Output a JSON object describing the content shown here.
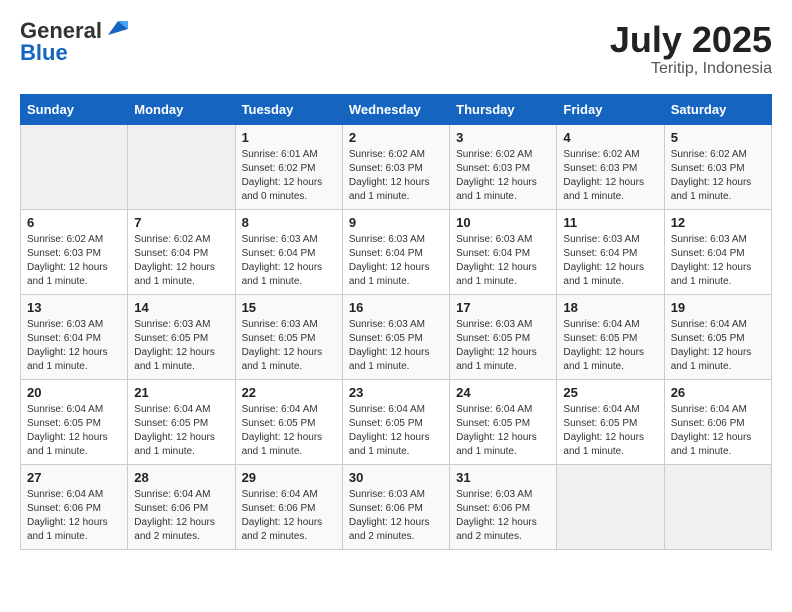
{
  "header": {
    "logo_general": "General",
    "logo_blue": "Blue",
    "month_year": "July 2025",
    "location": "Teritip, Indonesia"
  },
  "days_of_week": [
    "Sunday",
    "Monday",
    "Tuesday",
    "Wednesday",
    "Thursday",
    "Friday",
    "Saturday"
  ],
  "weeks": [
    [
      {
        "day": "",
        "empty": true
      },
      {
        "day": "",
        "empty": true
      },
      {
        "day": "1",
        "sunrise": "Sunrise: 6:01 AM",
        "sunset": "Sunset: 6:02 PM",
        "daylight": "Daylight: 12 hours and 0 minutes."
      },
      {
        "day": "2",
        "sunrise": "Sunrise: 6:02 AM",
        "sunset": "Sunset: 6:03 PM",
        "daylight": "Daylight: 12 hours and 1 minute."
      },
      {
        "day": "3",
        "sunrise": "Sunrise: 6:02 AM",
        "sunset": "Sunset: 6:03 PM",
        "daylight": "Daylight: 12 hours and 1 minute."
      },
      {
        "day": "4",
        "sunrise": "Sunrise: 6:02 AM",
        "sunset": "Sunset: 6:03 PM",
        "daylight": "Daylight: 12 hours and 1 minute."
      },
      {
        "day": "5",
        "sunrise": "Sunrise: 6:02 AM",
        "sunset": "Sunset: 6:03 PM",
        "daylight": "Daylight: 12 hours and 1 minute."
      }
    ],
    [
      {
        "day": "6",
        "sunrise": "Sunrise: 6:02 AM",
        "sunset": "Sunset: 6:03 PM",
        "daylight": "Daylight: 12 hours and 1 minute."
      },
      {
        "day": "7",
        "sunrise": "Sunrise: 6:02 AM",
        "sunset": "Sunset: 6:04 PM",
        "daylight": "Daylight: 12 hours and 1 minute."
      },
      {
        "day": "8",
        "sunrise": "Sunrise: 6:03 AM",
        "sunset": "Sunset: 6:04 PM",
        "daylight": "Daylight: 12 hours and 1 minute."
      },
      {
        "day": "9",
        "sunrise": "Sunrise: 6:03 AM",
        "sunset": "Sunset: 6:04 PM",
        "daylight": "Daylight: 12 hours and 1 minute."
      },
      {
        "day": "10",
        "sunrise": "Sunrise: 6:03 AM",
        "sunset": "Sunset: 6:04 PM",
        "daylight": "Daylight: 12 hours and 1 minute."
      },
      {
        "day": "11",
        "sunrise": "Sunrise: 6:03 AM",
        "sunset": "Sunset: 6:04 PM",
        "daylight": "Daylight: 12 hours and 1 minute."
      },
      {
        "day": "12",
        "sunrise": "Sunrise: 6:03 AM",
        "sunset": "Sunset: 6:04 PM",
        "daylight": "Daylight: 12 hours and 1 minute."
      }
    ],
    [
      {
        "day": "13",
        "sunrise": "Sunrise: 6:03 AM",
        "sunset": "Sunset: 6:04 PM",
        "daylight": "Daylight: 12 hours and 1 minute."
      },
      {
        "day": "14",
        "sunrise": "Sunrise: 6:03 AM",
        "sunset": "Sunset: 6:05 PM",
        "daylight": "Daylight: 12 hours and 1 minute."
      },
      {
        "day": "15",
        "sunrise": "Sunrise: 6:03 AM",
        "sunset": "Sunset: 6:05 PM",
        "daylight": "Daylight: 12 hours and 1 minute."
      },
      {
        "day": "16",
        "sunrise": "Sunrise: 6:03 AM",
        "sunset": "Sunset: 6:05 PM",
        "daylight": "Daylight: 12 hours and 1 minute."
      },
      {
        "day": "17",
        "sunrise": "Sunrise: 6:03 AM",
        "sunset": "Sunset: 6:05 PM",
        "daylight": "Daylight: 12 hours and 1 minute."
      },
      {
        "day": "18",
        "sunrise": "Sunrise: 6:04 AM",
        "sunset": "Sunset: 6:05 PM",
        "daylight": "Daylight: 12 hours and 1 minute."
      },
      {
        "day": "19",
        "sunrise": "Sunrise: 6:04 AM",
        "sunset": "Sunset: 6:05 PM",
        "daylight": "Daylight: 12 hours and 1 minute."
      }
    ],
    [
      {
        "day": "20",
        "sunrise": "Sunrise: 6:04 AM",
        "sunset": "Sunset: 6:05 PM",
        "daylight": "Daylight: 12 hours and 1 minute."
      },
      {
        "day": "21",
        "sunrise": "Sunrise: 6:04 AM",
        "sunset": "Sunset: 6:05 PM",
        "daylight": "Daylight: 12 hours and 1 minute."
      },
      {
        "day": "22",
        "sunrise": "Sunrise: 6:04 AM",
        "sunset": "Sunset: 6:05 PM",
        "daylight": "Daylight: 12 hours and 1 minute."
      },
      {
        "day": "23",
        "sunrise": "Sunrise: 6:04 AM",
        "sunset": "Sunset: 6:05 PM",
        "daylight": "Daylight: 12 hours and 1 minute."
      },
      {
        "day": "24",
        "sunrise": "Sunrise: 6:04 AM",
        "sunset": "Sunset: 6:05 PM",
        "daylight": "Daylight: 12 hours and 1 minute."
      },
      {
        "day": "25",
        "sunrise": "Sunrise: 6:04 AM",
        "sunset": "Sunset: 6:05 PM",
        "daylight": "Daylight: 12 hours and 1 minute."
      },
      {
        "day": "26",
        "sunrise": "Sunrise: 6:04 AM",
        "sunset": "Sunset: 6:06 PM",
        "daylight": "Daylight: 12 hours and 1 minute."
      }
    ],
    [
      {
        "day": "27",
        "sunrise": "Sunrise: 6:04 AM",
        "sunset": "Sunset: 6:06 PM",
        "daylight": "Daylight: 12 hours and 1 minute."
      },
      {
        "day": "28",
        "sunrise": "Sunrise: 6:04 AM",
        "sunset": "Sunset: 6:06 PM",
        "daylight": "Daylight: 12 hours and 2 minutes."
      },
      {
        "day": "29",
        "sunrise": "Sunrise: 6:04 AM",
        "sunset": "Sunset: 6:06 PM",
        "daylight": "Daylight: 12 hours and 2 minutes."
      },
      {
        "day": "30",
        "sunrise": "Sunrise: 6:03 AM",
        "sunset": "Sunset: 6:06 PM",
        "daylight": "Daylight: 12 hours and 2 minutes."
      },
      {
        "day": "31",
        "sunrise": "Sunrise: 6:03 AM",
        "sunset": "Sunset: 6:06 PM",
        "daylight": "Daylight: 12 hours and 2 minutes."
      },
      {
        "day": "",
        "empty": true
      },
      {
        "day": "",
        "empty": true
      }
    ]
  ]
}
